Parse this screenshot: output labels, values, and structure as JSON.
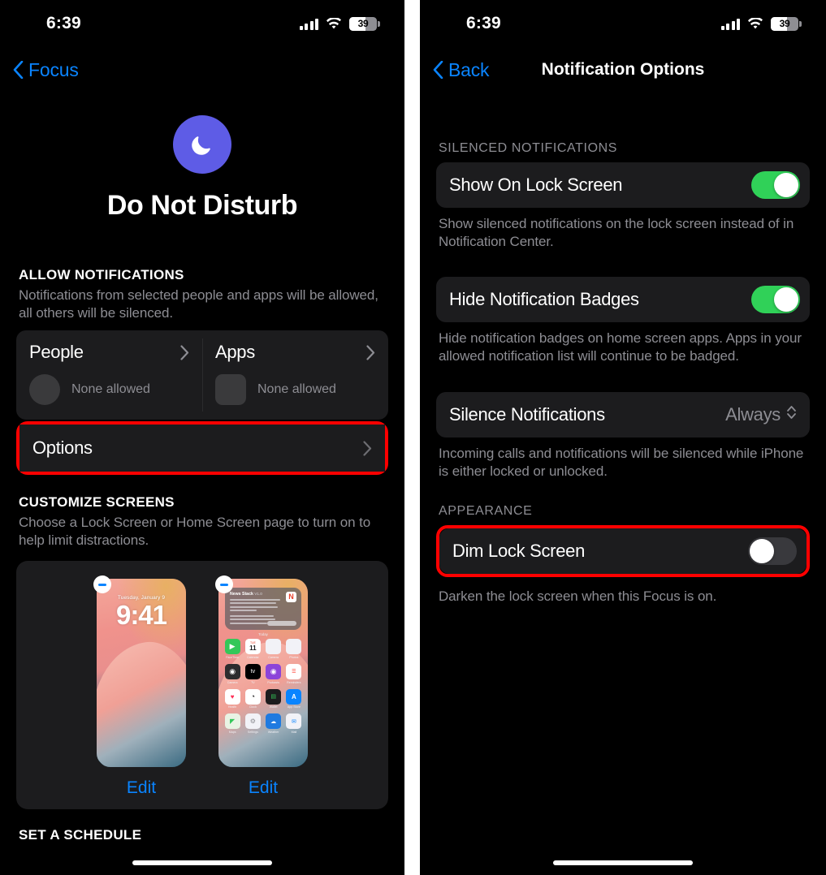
{
  "status_bar": {
    "time": "6:39",
    "battery_percent": "39",
    "cellular_icon": "cellular-signal-icon",
    "wifi_icon": "wifi-icon",
    "battery_icon": "battery-icon"
  },
  "left_screen": {
    "nav": {
      "back_label": "Focus",
      "back_icon": "chevron-left-icon"
    },
    "focus": {
      "icon": "crescent-moon-icon",
      "icon_color": "#5e5ce6",
      "name": "Do Not Disturb"
    },
    "allow_notifications": {
      "header": "ALLOW NOTIFICATIONS",
      "description": "Notifications from selected people and apps will be allowed, all others will be silenced.",
      "cells": [
        {
          "title": "People",
          "value": "None allowed",
          "placeholder_shape": "circle",
          "chevron_icon": "chevron-right-icon"
        },
        {
          "title": "Apps",
          "value": "None allowed",
          "placeholder_shape": "square",
          "chevron_icon": "chevron-right-icon"
        }
      ],
      "options_row": {
        "label": "Options",
        "chevron_icon": "chevron-right-icon",
        "highlighted": true,
        "highlight_color": "#ff0000"
      }
    },
    "customize_screens": {
      "header": "CUSTOMIZE SCREENS",
      "description": "Choose a Lock Screen or Home Screen page to turn on to help limit distractions.",
      "previews": [
        {
          "type": "lock-screen",
          "date": "Tuesday, January 9",
          "time": "9:41",
          "remove_icon": "minus-circle-icon",
          "edit_label": "Edit"
        },
        {
          "type": "home-screen",
          "widget": {
            "title": "News Stack",
            "version": "V1.0",
            "caption": "Today",
            "app_icon": "news-icon",
            "button_icon": "widget-button"
          },
          "apps": [
            {
              "name": "FaceTime",
              "icon": "facetime-icon",
              "color": "#34c759",
              "glyph": "▶"
            },
            {
              "name": "Calendar",
              "icon": "calendar-icon",
              "color": "#ffffff",
              "glyph": "11"
            },
            {
              "name": "Camera",
              "icon": "photos-icon",
              "color": "#ffffff",
              "glyph": ""
            },
            {
              "name": "Photos",
              "icon": "photos-icon",
              "color": "#ffffff",
              "glyph": ""
            },
            {
              "name": "Camera",
              "icon": "camera-icon",
              "color": "#2c2c2e",
              "glyph": "◉"
            },
            {
              "name": "TV",
              "icon": "apple-tv-icon",
              "color": "#000000",
              "glyph": "tv"
            },
            {
              "name": "Podcasts",
              "icon": "podcasts-icon",
              "color": "#8c44d9",
              "glyph": "◉"
            },
            {
              "name": "Reminders",
              "icon": "reminders-icon",
              "color": "#ffffff",
              "glyph": ""
            },
            {
              "name": "Health",
              "icon": "health-icon",
              "color": "#ffffff",
              "glyph": "♥"
            },
            {
              "name": "Clock",
              "icon": "clock-icon",
              "color": "#ffffff",
              "glyph": ""
            },
            {
              "name": "Wallet",
              "icon": "wallet-icon",
              "color": "#1c1c1e",
              "glyph": ""
            },
            {
              "name": "App Store",
              "icon": "app-store-icon",
              "color": "#0a84ff",
              "glyph": "A"
            },
            {
              "name": "Maps",
              "icon": "maps-icon",
              "color": "#ffffff",
              "glyph": ""
            },
            {
              "name": "Settings",
              "icon": "settings-icon",
              "color": "#ffffff",
              "glyph": ""
            },
            {
              "name": "Weather",
              "icon": "weather-icon",
              "color": "#1f7ae0",
              "glyph": ""
            },
            {
              "name": "Mail",
              "icon": "mail-icon",
              "color": "#ffffff",
              "glyph": ""
            }
          ],
          "remove_icon": "minus-circle-icon",
          "edit_label": "Edit"
        }
      ]
    },
    "set_a_schedule_header": "SET A SCHEDULE"
  },
  "right_screen": {
    "nav": {
      "back_label": "Back",
      "back_icon": "chevron-left-icon",
      "title": "Notification Options"
    },
    "silenced_notifications": {
      "header": "SILENCED NOTIFICATIONS",
      "rows": [
        {
          "label": "Show On Lock Screen",
          "toggle_state": "on",
          "toggle_color": "#30d158",
          "description": "Show silenced notifications on the lock screen instead of in Notification Center."
        },
        {
          "label": "Hide Notification Badges",
          "toggle_state": "on",
          "toggle_color": "#30d158",
          "description": "Hide notification badges on home screen apps. Apps in your allowed notification list will continue to be badged."
        }
      ],
      "value_row": {
        "label": "Silence Notifications",
        "value": "Always",
        "chevron_icon": "chevron-up-down-icon",
        "description": "Incoming calls and notifications will be silenced while iPhone is either locked or unlocked."
      }
    },
    "appearance": {
      "header": "APPEARANCE",
      "row": {
        "label": "Dim Lock Screen",
        "toggle_state": "off",
        "toggle_color": "#39393d",
        "description": "Darken the lock screen when this Focus is on.",
        "highlighted": true,
        "highlight_color": "#ff0000"
      }
    }
  }
}
